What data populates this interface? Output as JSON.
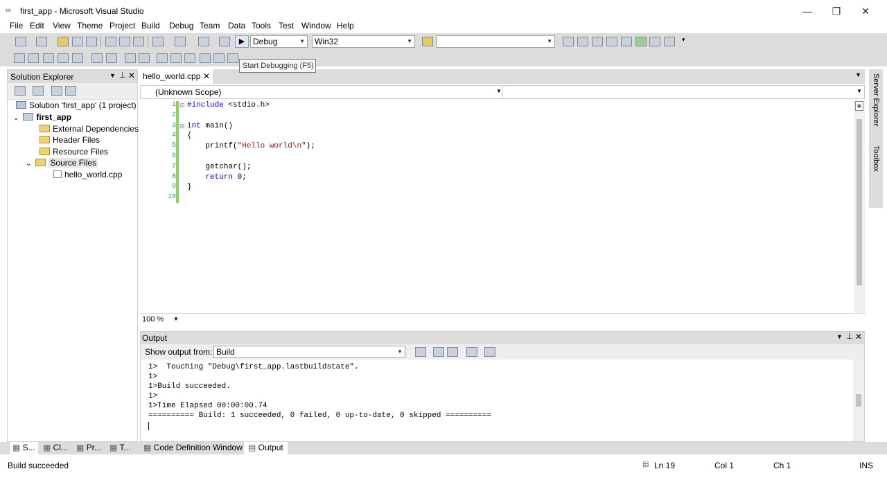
{
  "window": {
    "title": "first_app - Microsoft Visual Studio",
    "controls": {
      "minimize": "—",
      "restore": "❐",
      "close": "✕"
    }
  },
  "menu": [
    "File",
    "Edit",
    "View",
    "Theme",
    "Project",
    "Build",
    "Debug",
    "Team",
    "Data",
    "Tools",
    "Test",
    "Window",
    "Help"
  ],
  "toolbar": {
    "config": "Debug",
    "platform": "Win32",
    "find": ""
  },
  "tooltip": "Start Debugging (F5)",
  "solution_explorer": {
    "title": "Solution Explorer",
    "tree": {
      "solution": "Solution 'first_app' (1 project)",
      "project": "first_app",
      "external": "External Dependencies",
      "headers": "Header Files",
      "resources": "Resource Files",
      "sources": "Source Files",
      "file": "hello_world.cpp"
    }
  },
  "editor": {
    "tab": "hello_world.cpp",
    "scope": "(Unknown Scope)",
    "zoom": "100 %",
    "line_numbers": [
      "1",
      "2",
      "3",
      "4",
      "5",
      "6",
      "7",
      "8",
      "9",
      "10"
    ],
    "code": {
      "l1a": "#include ",
      "l1b": "<stdio.h>",
      "l3a": "int",
      "l3b": " main()",
      "l4": "{",
      "l5a": "    printf(",
      "l5b": "\"Hello world\\n\"",
      "l5c": ");",
      "l7": "    getchar();",
      "l8a": "    ",
      "l8b": "return",
      "l8c": " 0;",
      "l9": "}"
    }
  },
  "output": {
    "title": "Output",
    "show_from_label": "Show output from:",
    "source": "Build",
    "lines": [
      "1>  Touching \"Debug\\first_app.lastbuildstate\".",
      "1>",
      "1>Build succeeded.",
      "1>",
      "1>Time Elapsed 00:00:00.74",
      "========== Build: 1 succeeded, 0 failed, 0 up-to-date, 0 skipped =========="
    ]
  },
  "bottom_tabs": [
    "S...",
    "Cl...",
    "Pr...",
    "T...",
    "Code Definition Window",
    "Output"
  ],
  "side_tabs": [
    "Server Explorer",
    "Toolbox"
  ],
  "status": {
    "message": "Build succeeded",
    "ln": "Ln 19",
    "col": "Col 1",
    "ch": "Ch 1",
    "mode": "INS"
  }
}
